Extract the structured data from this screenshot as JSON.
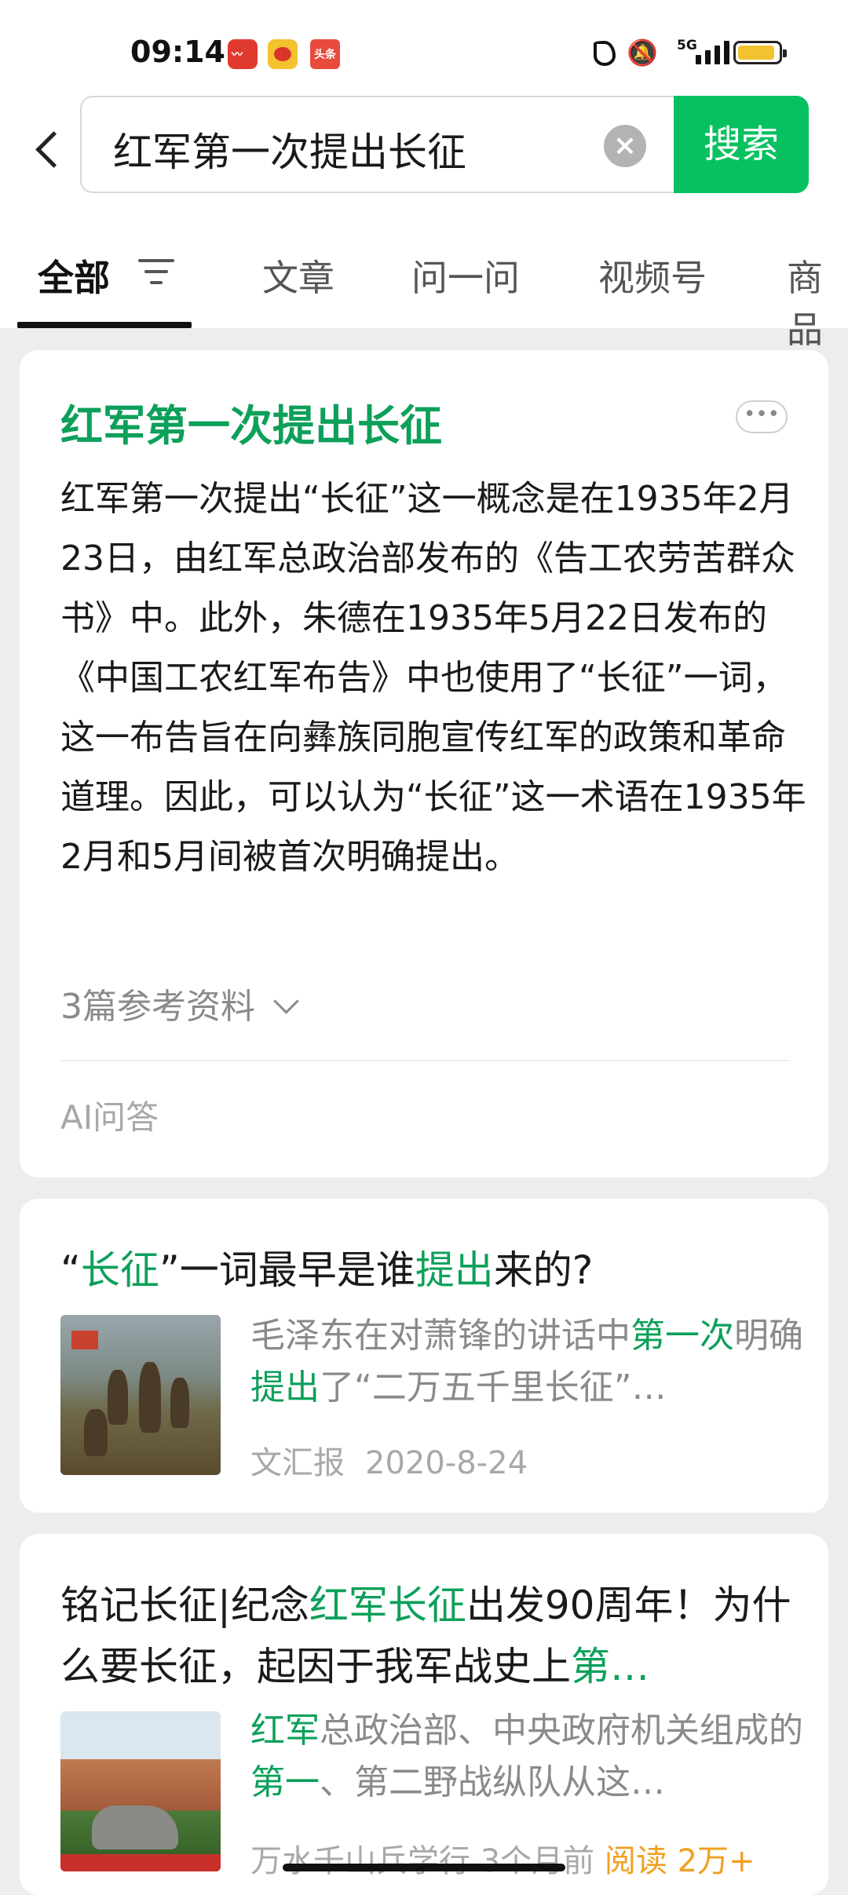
{
  "status_bar": {
    "time": "09:14",
    "network": "5G"
  },
  "search": {
    "query": "红军第一次提出长征",
    "button_label": "搜索"
  },
  "tabs": [
    {
      "label": "全部",
      "active": true
    },
    {
      "label": "文章"
    },
    {
      "label": "问一问"
    },
    {
      "label": "视频号"
    },
    {
      "label": "商品"
    }
  ],
  "ai_card": {
    "title": "红军第一次提出长征",
    "more_label": "•••",
    "body": "红军第一次提出“长征”这一概念是在1935年2月23日，由红军总政治部发布的《告工农劳苦群众书》中。此外，朱德在1935年5月22日发布的《中国工农红军布告》中也使用了“长征”一词，这一布告旨在向彝族同胞宣传红军的政策和革命道理。因此，可以认为“长征”这一术语在1935年2月和5月间被首次明确提出。",
    "references": "3篇参考资料",
    "label": "AI问答"
  },
  "results": [
    {
      "title_parts": [
        {
          "text": "“"
        },
        {
          "text": "长征",
          "hl": true
        },
        {
          "text": "”一词最早是谁"
        },
        {
          "text": "提出",
          "hl": true
        },
        {
          "text": "来的?"
        }
      ],
      "snippet_parts": [
        {
          "text": "毛泽东在对萧锋的讲话中"
        },
        {
          "text": "第一次",
          "hl": true
        },
        {
          "text": "明确"
        },
        {
          "text": "提出",
          "hl": true
        },
        {
          "text": "了“二万五千里长征”…"
        }
      ],
      "source": "文汇报",
      "date": "2020-8-24"
    },
    {
      "title_parts": [
        {
          "text": "铭记长征|纪念"
        },
        {
          "text": "红军长征",
          "hl": true
        },
        {
          "text": "出发90周年！为什么要长征，起因于我军战史上"
        },
        {
          "text": "第…",
          "hl": true
        }
      ],
      "snippet_parts": [
        {
          "text": "红军",
          "hl": true
        },
        {
          "text": "总政治部、中央政府机关组成的"
        },
        {
          "text": "第一",
          "hl": true
        },
        {
          "text": "、第二野战纵队从这…"
        }
      ],
      "source": "万水千山兵学行",
      "time": "3个月前",
      "extra": "阅读 2万+"
    }
  ],
  "colors": {
    "accent": "#07c160",
    "highlight": "#0da05a"
  }
}
